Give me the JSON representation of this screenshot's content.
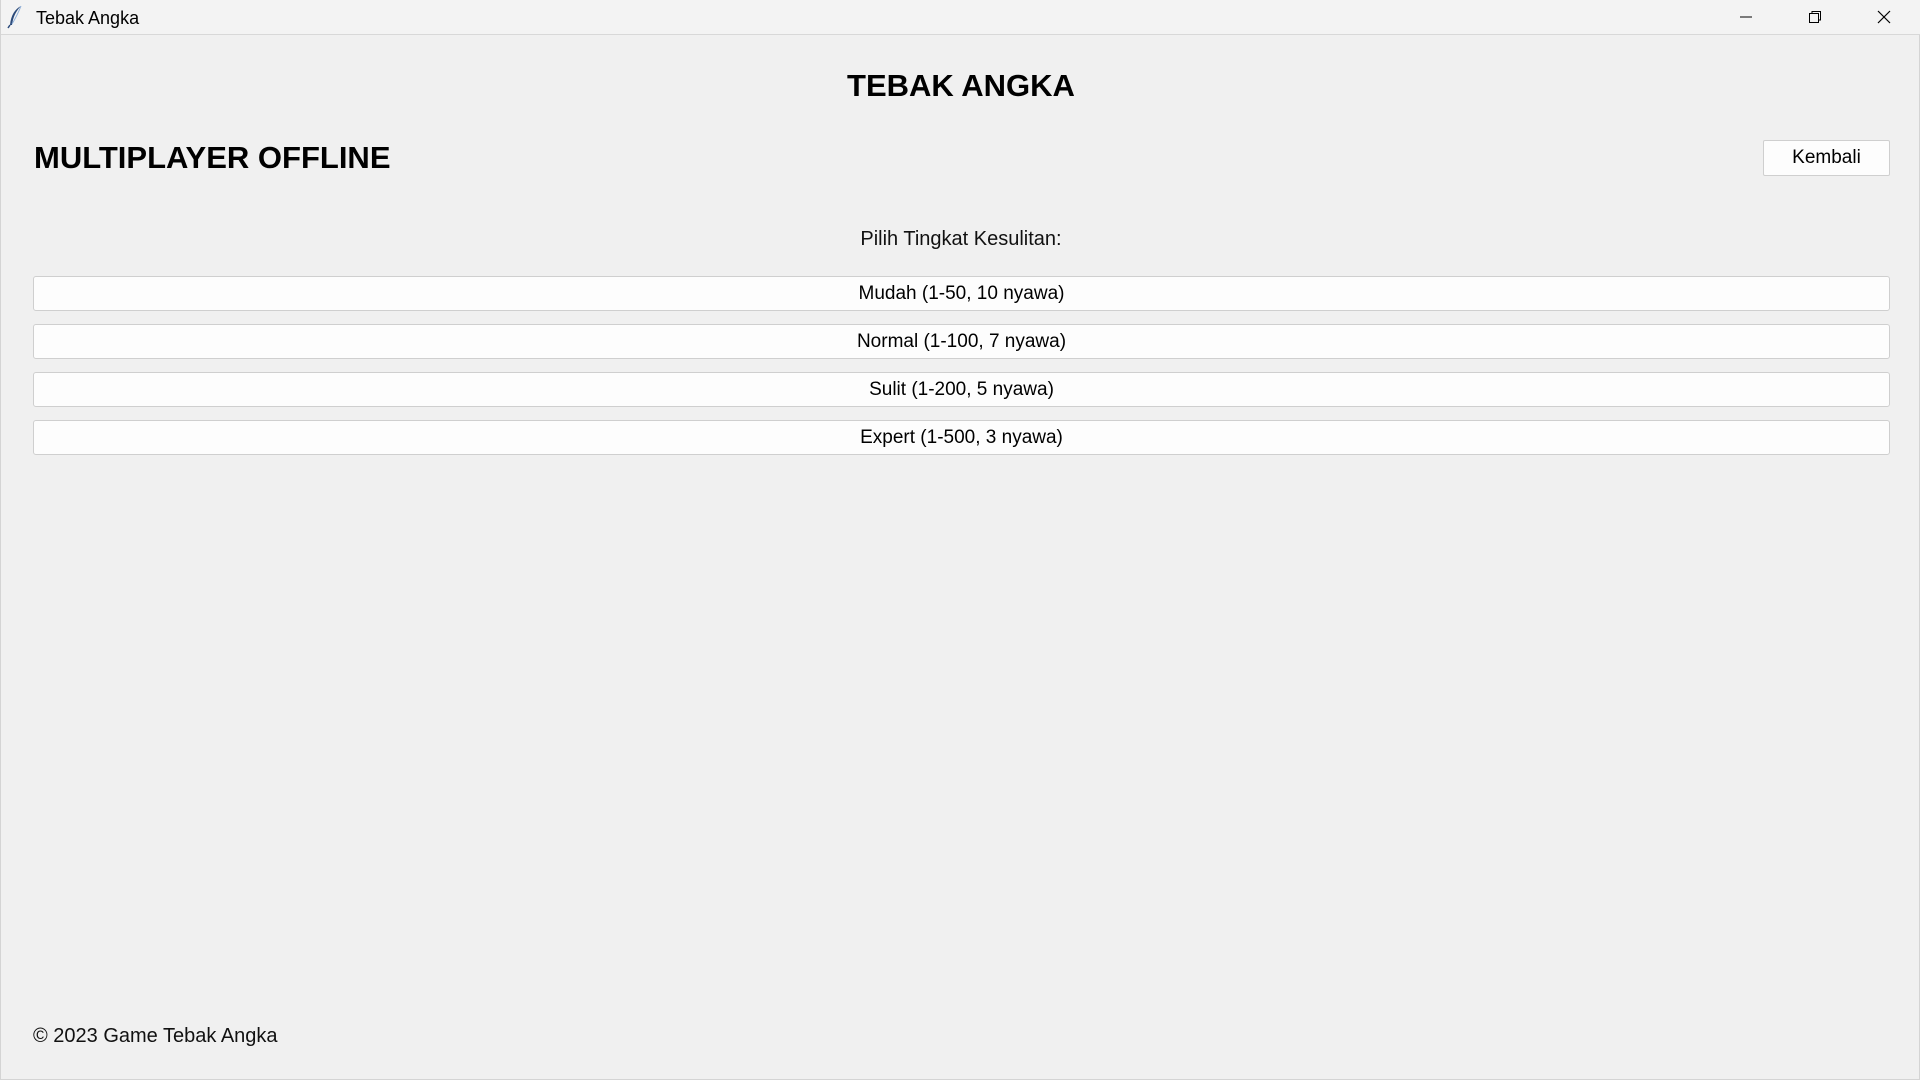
{
  "window": {
    "title": "Tebak Angka",
    "controls": [
      "minimize",
      "restore",
      "close"
    ]
  },
  "header": {
    "heading": "TEBAK ANGKA",
    "mode_title": "MULTIPLAYER OFFLINE",
    "back_label": "Kembali"
  },
  "difficulty": {
    "prompt": "Pilih Tingkat Kesulitan:",
    "options": [
      "Mudah (1-50, 10 nyawa)",
      "Normal (1-100, 7 nyawa)",
      "Sulit (1-200, 5 nyawa)",
      "Expert (1-500, 3 nyawa)"
    ]
  },
  "footer": {
    "text": "© 2023 Game Tebak Angka"
  },
  "icons": {
    "app": "feather-icon",
    "minimize": "minimize-icon",
    "restore": "restore-icon",
    "close": "close-icon"
  }
}
